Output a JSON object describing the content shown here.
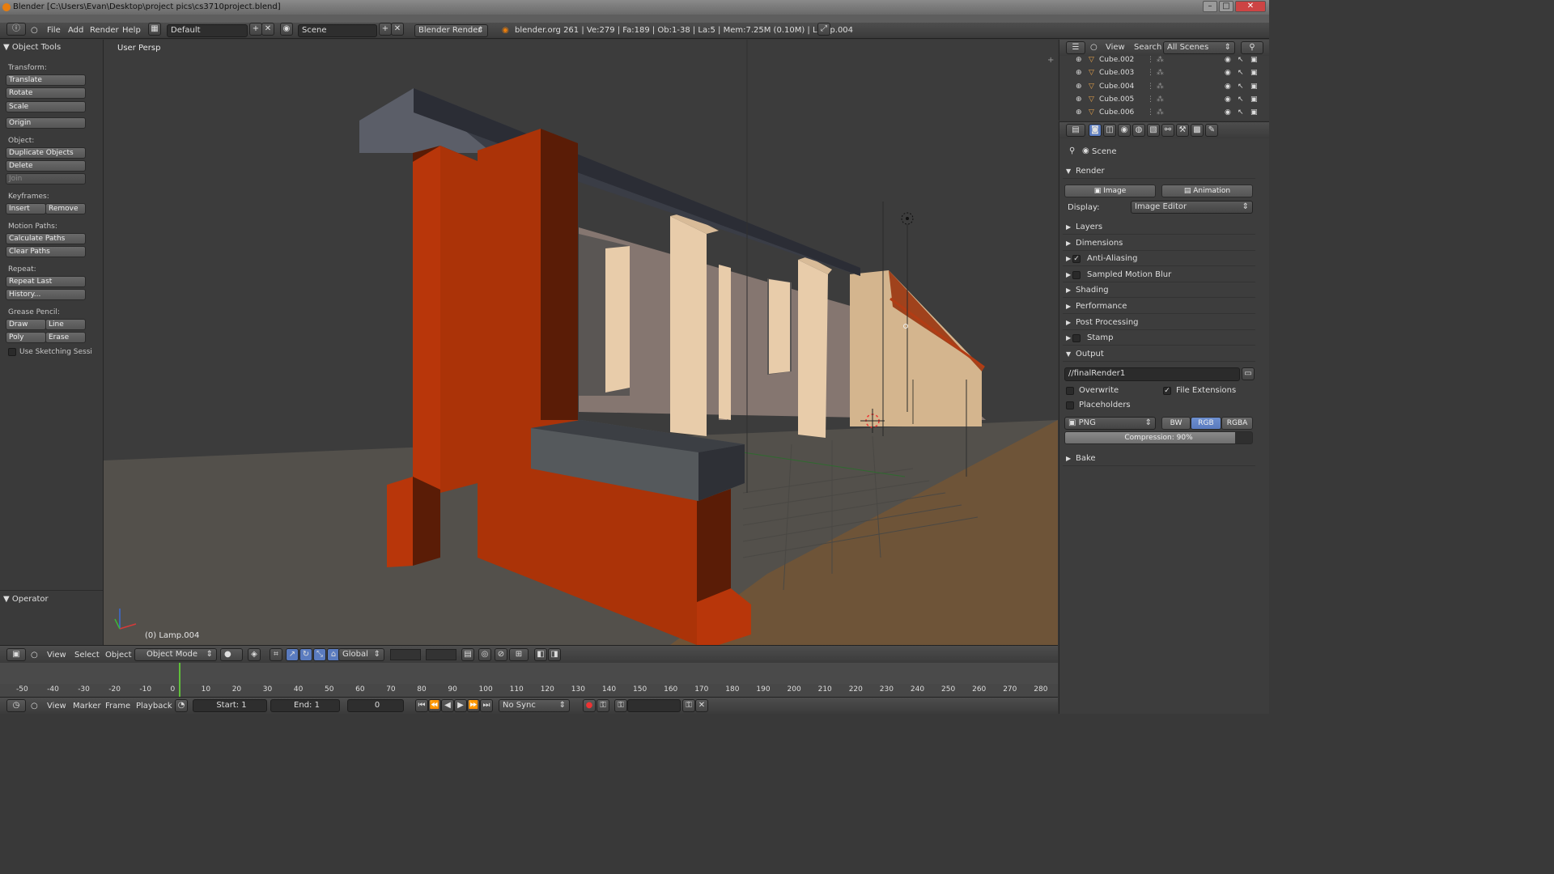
{
  "window": {
    "title": "Blender [C:\\Users\\Evan\\Desktop\\project pics\\cs3710project.blend]",
    "minimize": "–",
    "maximize": "□",
    "close": "✕"
  },
  "info_header": {
    "menus": [
      "File",
      "Add",
      "Render",
      "Help"
    ],
    "layout": "Default",
    "scene": "Scene",
    "render_engine": "Blender Render",
    "stats": "blender.org 261 | Ve:279 | Fa:189 | Ob:1-38 | La:5 | Mem:7.25M (0.10M) | Lamp.004"
  },
  "tool_panel": {
    "title": "Object Tools",
    "transform_label": "Transform:",
    "translate": "Translate",
    "rotate": "Rotate",
    "scale": "Scale",
    "origin": "Origin",
    "object_label": "Object:",
    "duplicate": "Duplicate Objects",
    "delete": "Delete",
    "join": "Join",
    "keyframes_label": "Keyframes:",
    "insert": "Insert",
    "remove": "Remove",
    "motion_paths_label": "Motion Paths:",
    "calc_paths": "Calculate Paths",
    "clear_paths": "Clear Paths",
    "repeat_label": "Repeat:",
    "repeat_last": "Repeat Last",
    "history": "History...",
    "grease_label": "Grease Pencil:",
    "draw": "Draw",
    "line": "Line",
    "poly": "Poly",
    "erase": "Erase",
    "sketching": "Use Sketching Sessi",
    "operator": "Operator"
  },
  "viewport": {
    "view_name": "User Persp",
    "active_object": "(0) Lamp.004"
  },
  "view3d_header": {
    "menus": [
      "View",
      "Select",
      "Object"
    ],
    "mode": "Object Mode",
    "orientation": "Global"
  },
  "timeline": {
    "ticks": [
      "-50",
      "-40",
      "-30",
      "-20",
      "-10",
      "0",
      "10",
      "20",
      "30",
      "40",
      "50",
      "60",
      "70",
      "80",
      "90",
      "100",
      "110",
      "120",
      "130",
      "140",
      "150",
      "160",
      "170",
      "180",
      "190",
      "200",
      "210",
      "220",
      "230",
      "240",
      "250",
      "260",
      "270",
      "280"
    ],
    "menus": [
      "View",
      "Marker",
      "Frame",
      "Playback"
    ],
    "start": "Start: 1",
    "end": "End: 1",
    "current": "0",
    "sync": "No Sync"
  },
  "outliner": {
    "view": "View",
    "search": "Search",
    "filter": "All Scenes",
    "items": [
      "Cube.002",
      "Cube.003",
      "Cube.004",
      "Cube.005",
      "Cube.006"
    ]
  },
  "properties": {
    "context": "Scene",
    "render_section": "Render",
    "image_btn": "Image",
    "animation_btn": "Animation",
    "display_label": "Display:",
    "display_value": "Image Editor",
    "sections": [
      "Layers",
      "Dimensions",
      "Anti-Aliasing",
      "Sampled Motion Blur",
      "Shading",
      "Performance",
      "Post Processing",
      "Stamp"
    ],
    "output_section": "Output",
    "output_path": "//finalRender1",
    "overwrite": "Overwrite",
    "file_extensions": "File Extensions",
    "placeholders": "Placeholders",
    "format": "PNG",
    "bw": "BW",
    "rgb": "RGB",
    "rgba": "RGBA",
    "compression": "Compression: 90%",
    "compression_value": 90,
    "bake": "Bake"
  },
  "colors": {
    "accent": "#5a7bbf",
    "wall_orange": "#b03a0e",
    "blender_orange": "#e87d0d"
  }
}
